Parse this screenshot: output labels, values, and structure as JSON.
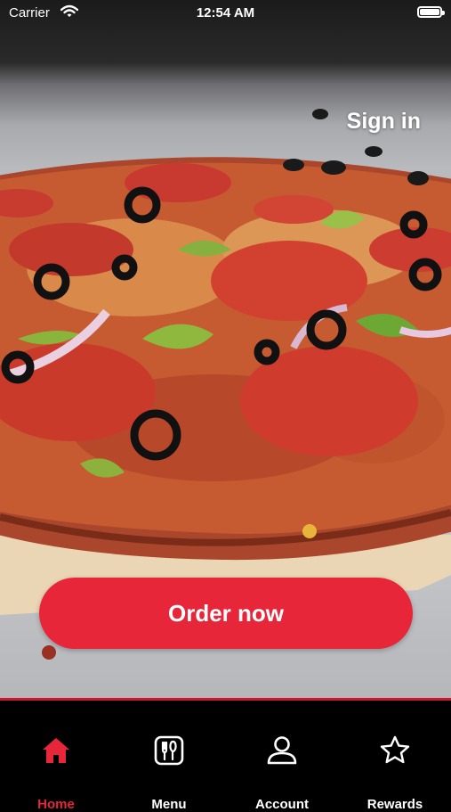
{
  "status_bar": {
    "carrier": "Carrier",
    "time": "12:54 AM"
  },
  "header": {
    "sign_in": "Sign in"
  },
  "hero": {
    "image": "pizza-photo"
  },
  "cta": {
    "order_label": "Order now"
  },
  "tab_bar": {
    "items": [
      {
        "label": "Home",
        "icon": "home-icon",
        "active": true
      },
      {
        "label": "Menu",
        "icon": "menu-icon",
        "active": false
      },
      {
        "label": "Account",
        "icon": "account-icon",
        "active": false
      },
      {
        "label": "Rewards",
        "icon": "star-icon",
        "active": false
      }
    ]
  },
  "colors": {
    "accent": "#e7263a",
    "tab_bar_bg": "#000000",
    "tab_border": "#c81a2b"
  }
}
